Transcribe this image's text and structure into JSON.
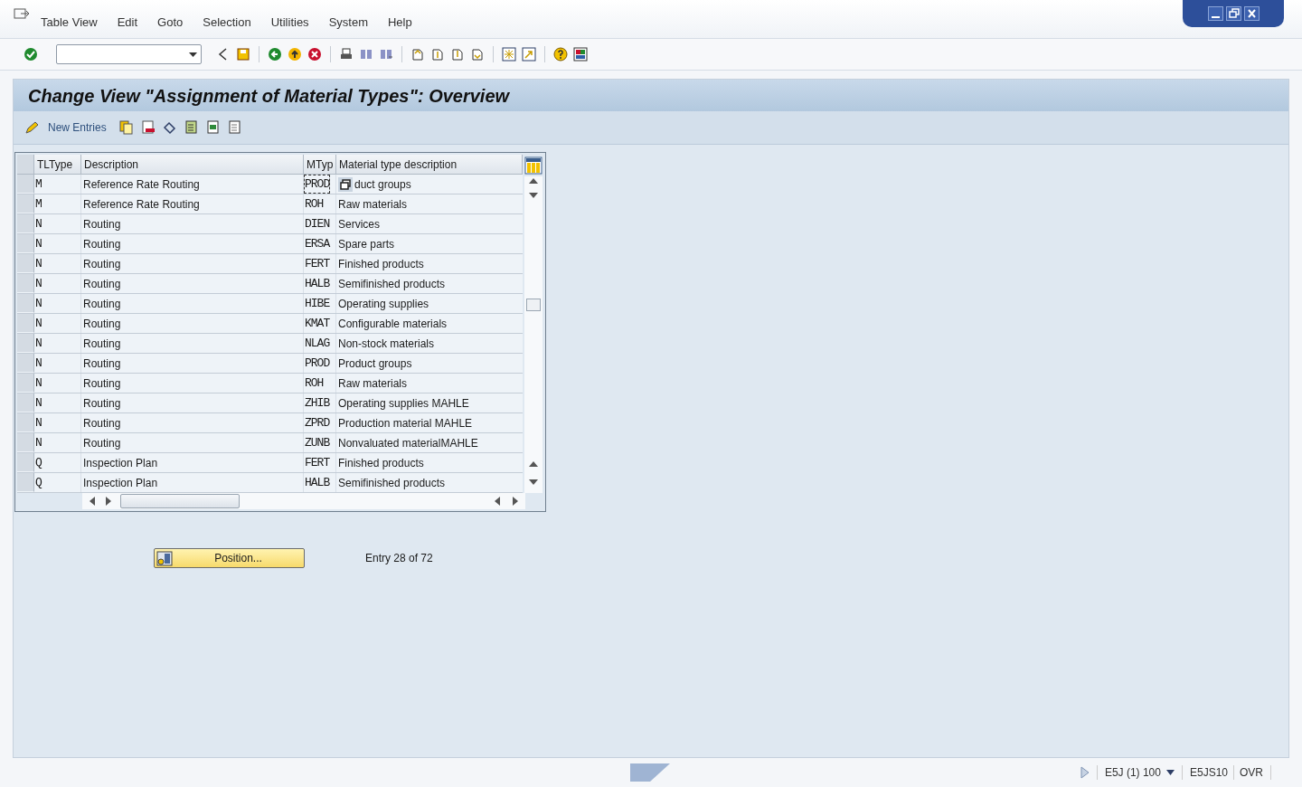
{
  "menu": [
    "Table View",
    "Edit",
    "Goto",
    "Selection",
    "Utilities",
    "System",
    "Help"
  ],
  "title": "Change View \"Assignment of Material Types\": Overview",
  "app_toolbar": {
    "new_entries": "New Entries"
  },
  "table": {
    "columns": [
      "TLType",
      "Description",
      "MTyp",
      "Material type description"
    ],
    "rows": [
      {
        "tltype": "M",
        "description": "Reference Rate Routing",
        "mtyp": "PROD",
        "mtyp_focused": true,
        "material_description": "duct groups"
      },
      {
        "tltype": "M",
        "description": "Reference Rate Routing",
        "mtyp": "ROH",
        "mtyp_focused": false,
        "material_description": "Raw materials"
      },
      {
        "tltype": "N",
        "description": "Routing",
        "mtyp": "DIEN",
        "mtyp_focused": false,
        "material_description": "Services"
      },
      {
        "tltype": "N",
        "description": "Routing",
        "mtyp": "ERSA",
        "mtyp_focused": false,
        "material_description": "Spare parts"
      },
      {
        "tltype": "N",
        "description": "Routing",
        "mtyp": "FERT",
        "mtyp_focused": false,
        "material_description": "Finished products"
      },
      {
        "tltype": "N",
        "description": "Routing",
        "mtyp": "HALB",
        "mtyp_focused": false,
        "material_description": "Semifinished products"
      },
      {
        "tltype": "N",
        "description": "Routing",
        "mtyp": "HIBE",
        "mtyp_focused": false,
        "material_description": "Operating supplies"
      },
      {
        "tltype": "N",
        "description": "Routing",
        "mtyp": "KMAT",
        "mtyp_focused": false,
        "material_description": "Configurable materials"
      },
      {
        "tltype": "N",
        "description": "Routing",
        "mtyp": "NLAG",
        "mtyp_focused": false,
        "material_description": "Non-stock materials"
      },
      {
        "tltype": "N",
        "description": "Routing",
        "mtyp": "PROD",
        "mtyp_focused": false,
        "material_description": "Product groups"
      },
      {
        "tltype": "N",
        "description": "Routing",
        "mtyp": "ROH",
        "mtyp_focused": false,
        "material_description": "Raw materials"
      },
      {
        "tltype": "N",
        "description": "Routing",
        "mtyp": "ZHIB",
        "mtyp_focused": false,
        "material_description": "Operating supplies MAHLE"
      },
      {
        "tltype": "N",
        "description": "Routing",
        "mtyp": "ZPRD",
        "mtyp_focused": false,
        "material_description": "Production material MAHLE"
      },
      {
        "tltype": "N",
        "description": "Routing",
        "mtyp": "ZUNB",
        "mtyp_focused": false,
        "material_description": "Nonvaluated materialMAHLE"
      },
      {
        "tltype": "Q",
        "description": "Inspection Plan",
        "mtyp": "FERT",
        "mtyp_focused": false,
        "material_description": "Finished products"
      },
      {
        "tltype": "Q",
        "description": "Inspection Plan",
        "mtyp": "HALB",
        "mtyp_focused": false,
        "material_description": "Semifinished products"
      }
    ]
  },
  "position_button": "Position...",
  "entry_info": "Entry 28 of 72",
  "status_bar": {
    "system": "E5J (1) 100",
    "server": "E5JS10",
    "mode": "OVR"
  }
}
